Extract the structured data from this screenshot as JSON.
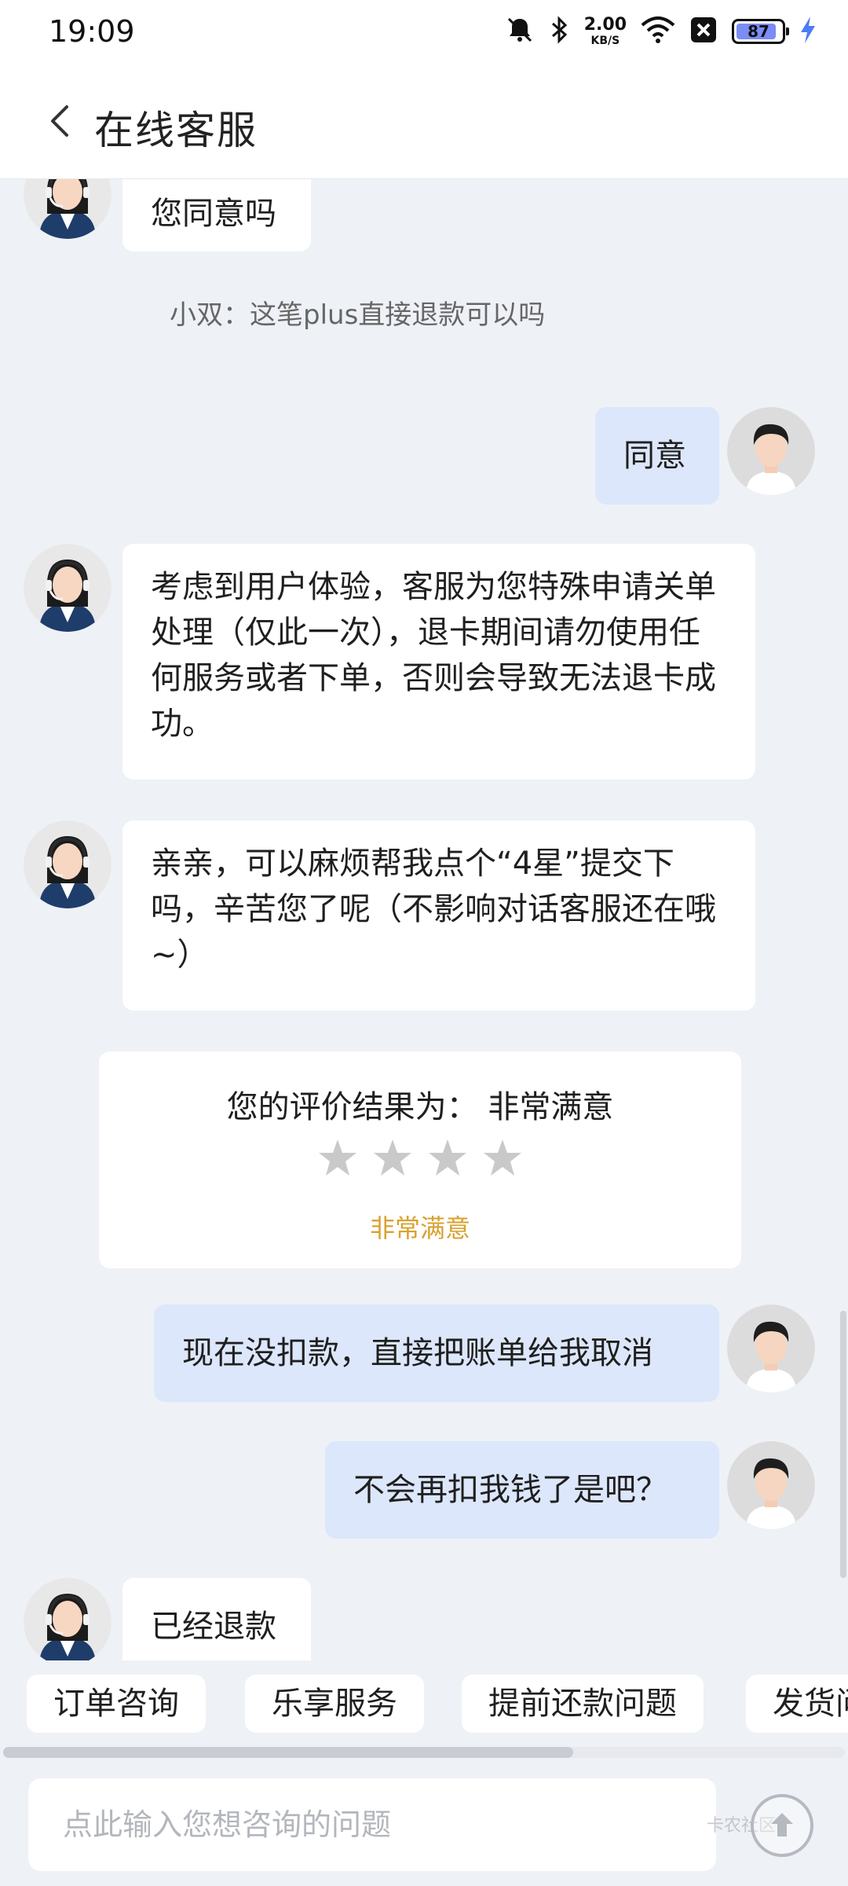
{
  "status_bar": {
    "time": "19:09",
    "speed_value": "2.00",
    "speed_unit": "KB/S",
    "battery": "87"
  },
  "header": {
    "title": "在线客服"
  },
  "chat": {
    "agent_msg_1": "您同意吗",
    "system_msg": "小双：这笔plus直接退款可以吗",
    "user_msg_1": "同意",
    "agent_msg_2": "考虑到用户体验，客服为您特殊申请关单处理（仅此一次），退卡期间请勿使用任何服务或者下单，否则会导致无法退卡成功。",
    "agent_msg_3": "亲亲，可以麻烦帮我点个“4星”提交下吗，辛苦您了呢（不影响对话客服还在哦~）",
    "rating": {
      "title": "您的评价结果为： 非常满意",
      "stars_total": 4,
      "stars_filled": 4,
      "label": "非常满意"
    },
    "user_msg_2": "现在没扣款，直接把账单给我取消",
    "user_msg_3": "不会再扣我钱了是吧？",
    "agent_msg_4": "已经退款"
  },
  "quick_actions": [
    "订单咨询",
    "乐享服务",
    "提前还款问题",
    "发货问"
  ],
  "input": {
    "placeholder": "点此输入您想咨询的问题"
  },
  "watermark": "卡农社区",
  "colors": {
    "user_bubble": "#dde7fb",
    "agent_bubble": "#ffffff",
    "background": "#eef1f6",
    "rating_label": "#d9a12f"
  },
  "icons": [
    "back-icon",
    "mute-icon",
    "bluetooth-icon",
    "wifi-icon",
    "close-box-icon",
    "battery-icon",
    "charging-icon",
    "agent-avatar-icon",
    "user-avatar-icon",
    "star-icon",
    "upload-icon"
  ]
}
